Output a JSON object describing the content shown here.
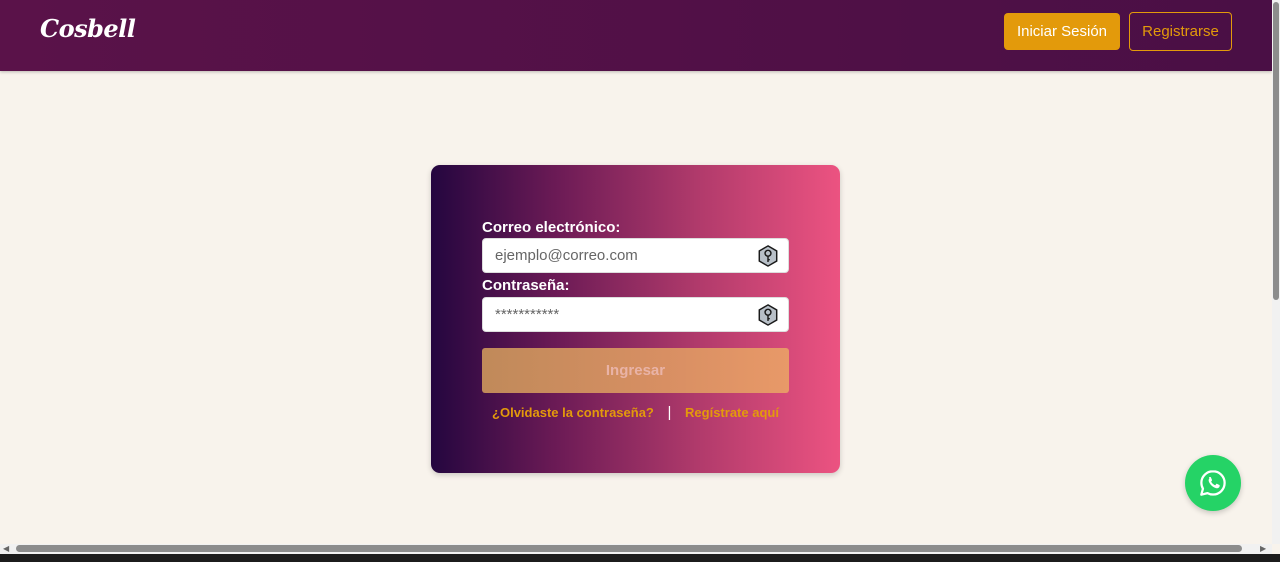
{
  "navbar": {
    "brand": "Cosbell",
    "login_label": "Iniciar Sesión",
    "register_label": "Registrarse"
  },
  "login_form": {
    "email_label": "Correo electrónico:",
    "email_placeholder": "ejemplo@correo.com",
    "password_label": "Contraseña:",
    "password_placeholder": "***********",
    "submit_label": "Ingresar",
    "forgot_link": "¿Olvidaste la contraseña?",
    "separator": "|",
    "register_link": "Regístrate aquí",
    "field_icon": "key-icon"
  },
  "floating": {
    "icon": "whatsapp-icon"
  },
  "colors": {
    "navbar": "#4a0f45",
    "accent": "#e39a0b",
    "card_gradient_start": "#24063f",
    "card_gradient_end": "#ec5381",
    "page_background": "#f8f3ec",
    "whatsapp": "#25d366"
  }
}
